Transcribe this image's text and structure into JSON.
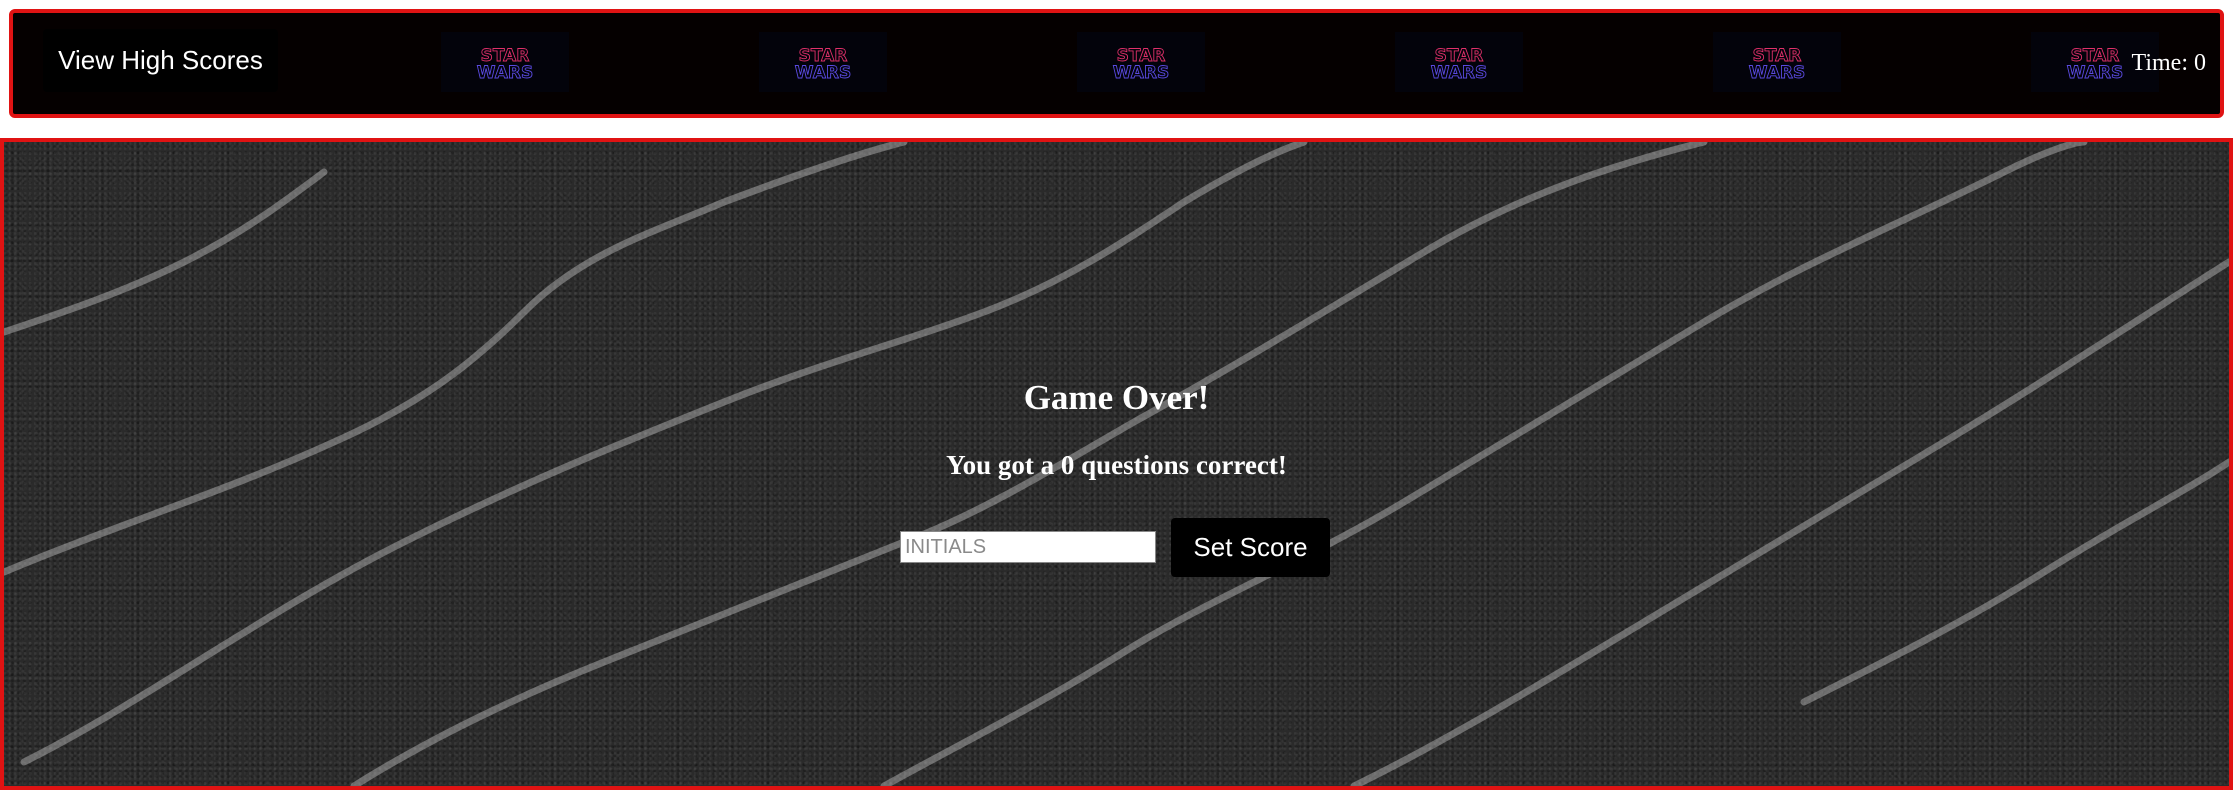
{
  "header": {
    "high_scores_label": "View High Scores",
    "logo_text_top": "STAR",
    "logo_text_bottom": "WARS",
    "logo_count": 6,
    "timer_label": "Time: 0"
  },
  "game_over": {
    "title": "Game Over!",
    "message": "You got a 0 questions correct!",
    "initials_placeholder": "INITIALS",
    "initials_value": "",
    "submit_label": "Set Score"
  },
  "colors": {
    "border": "#e01313",
    "header_bg": "#050000",
    "button_bg": "#000000",
    "text": "#ffffff",
    "logo_outline_top": "#e0306a",
    "logo_outline_bottom": "#5a4ae0"
  }
}
